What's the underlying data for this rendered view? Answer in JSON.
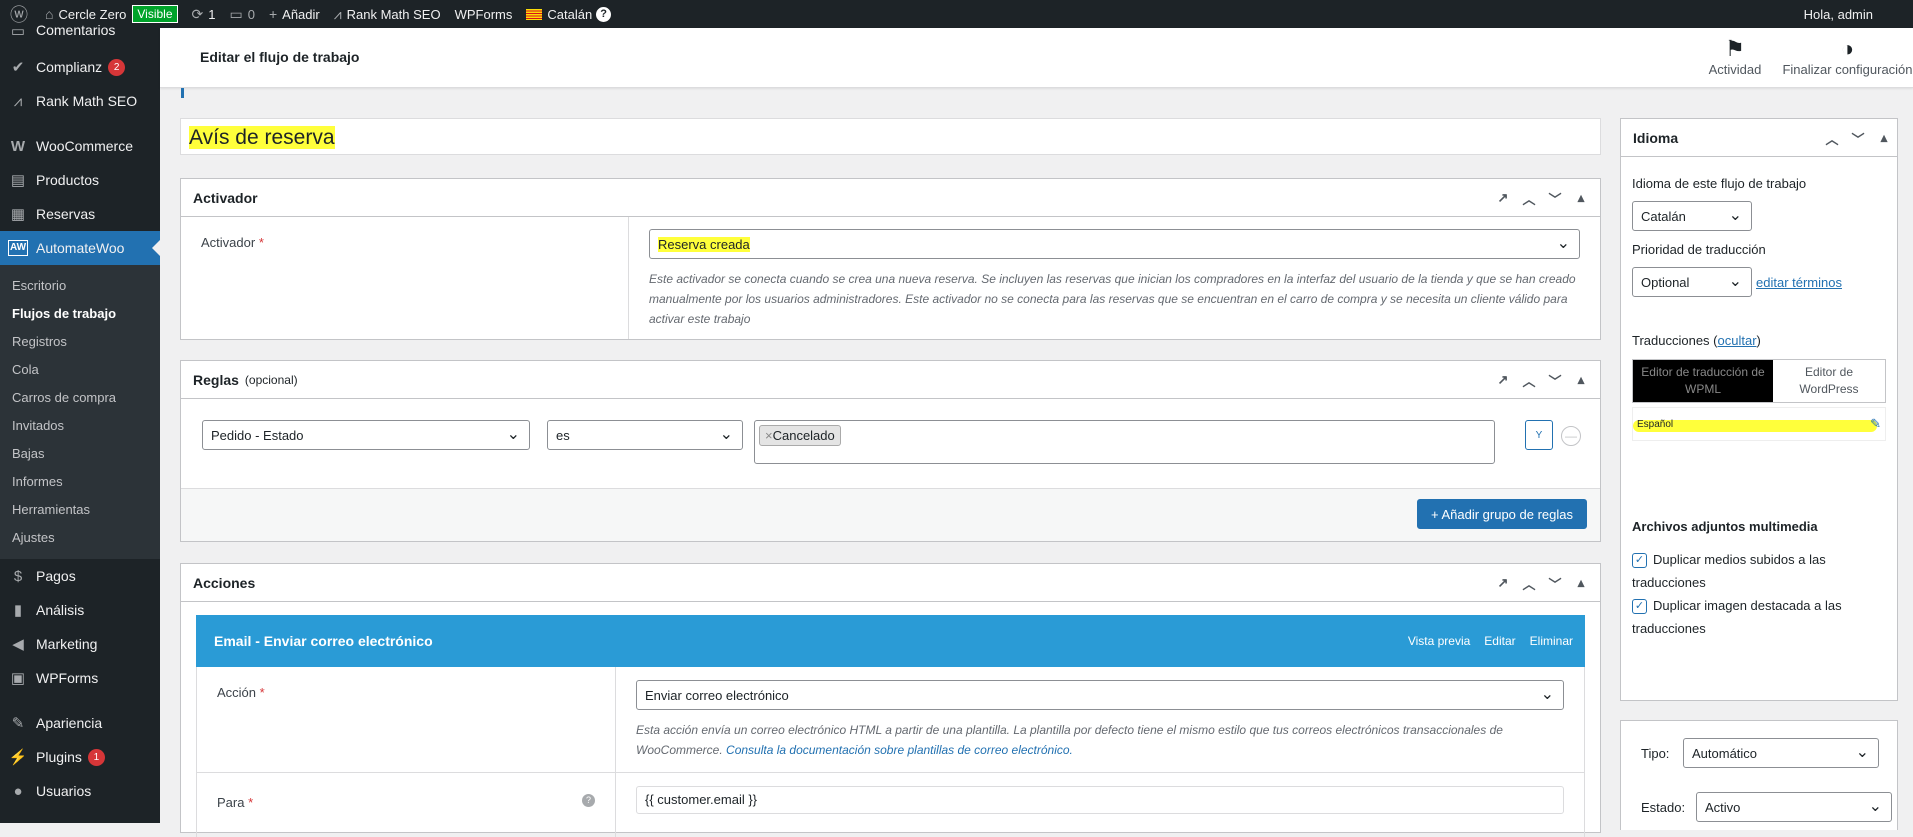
{
  "adminbar": {
    "site_name": "Cercle Zero",
    "visibility": "Visible",
    "updates_count": "1",
    "comments_count": "0",
    "add_new": "Añadir",
    "rank_math": "Rank Math SEO",
    "wpforms": "WPForms",
    "language": "Catalán",
    "help": "?",
    "greeting": "Hola, admin"
  },
  "sidebar": {
    "items": [
      {
        "label": "Comentarios",
        "icon": "comment-icon"
      },
      {
        "label": "Complianz",
        "icon": "check-icon",
        "badge": "2"
      },
      {
        "label": "Rank Math SEO",
        "icon": "chart-icon"
      },
      {
        "label": "WooCommerce",
        "icon": "woocommerce-icon"
      },
      {
        "label": "Productos",
        "icon": "archive-icon"
      },
      {
        "label": "Reservas",
        "icon": "calendar-icon"
      },
      {
        "label": "AutomateWoo",
        "icon": "automatewoo-icon"
      }
    ],
    "submenu": [
      "Escritorio",
      "Flujos de trabajo",
      "Registros",
      "Cola",
      "Carros de compra",
      "Invitados",
      "Bajas",
      "Informes",
      "Herramientas",
      "Ajustes"
    ],
    "bottom_items": [
      {
        "label": "Pagos",
        "icon": "dollar-icon"
      },
      {
        "label": "Análisis",
        "icon": "bar-chart-icon"
      },
      {
        "label": "Marketing",
        "icon": "megaphone-icon"
      },
      {
        "label": "WPForms",
        "icon": "form-icon"
      },
      {
        "label": "Apariencia",
        "icon": "paintbrush-icon"
      },
      {
        "label": "Plugins",
        "icon": "plugin-icon",
        "badge": "1"
      },
      {
        "label": "Usuarios",
        "icon": "user-icon"
      }
    ]
  },
  "header": {
    "title": "Editar el flujo de trabajo",
    "activity": "Actividad",
    "finish_setup": "Finalizar configuración"
  },
  "workflow_title": "Avís de reserva",
  "trigger": {
    "heading": "Activador",
    "label": "Activador",
    "required": "*",
    "value": "Reserva creada",
    "description": "Este activador se conecta cuando se crea una nueva reserva. Se incluyen las reservas que inician los compradores en la interfaz del usuario de la tienda y que se han creado manualmente por los usuarios administradores. Este activador no se conecta para las reservas que se encuentran en el carro de compra y se necesita un cliente válido para activar este trabajo"
  },
  "rules": {
    "heading": "Reglas",
    "optional": "(opcional)",
    "field": "Pedido - Estado",
    "operator": "es",
    "tag": "Cancelado",
    "and_button": "Y",
    "add_group": "+ Añadir grupo de reglas"
  },
  "actions": {
    "heading": "Acciones",
    "action_title": "Email - Enviar correo electrónico",
    "preview": "Vista previa",
    "edit": "Editar",
    "delete": "Eliminar",
    "action_label": "Acción",
    "action_value": "Enviar correo electrónico",
    "action_description": "Esta acción envía un correo electrónico HTML a partir de una plantilla. La plantilla por defecto tiene el mismo estilo que tus correos electrónicos transaccionales de WooCommerce.",
    "action_link": "Consulta la documentación sobre plantillas de correo electrónico.",
    "to_label": "Para",
    "to_value": "{{ customer.email }}"
  },
  "language_box": {
    "heading": "Idioma",
    "language_label": "Idioma de este flujo de trabajo",
    "language_value": "Catalán",
    "priority_label": "Prioridad de traducción",
    "priority_value": "Optional",
    "edit_terms": "editar términos",
    "translations_label": "Traducciones",
    "hide": "ocultar",
    "wpml_editor": "Editor de traducción de WPML",
    "wp_editor": "Editor de WordPress",
    "translation_lang": "Español",
    "media_heading": "Archivos adjuntos multimedia",
    "dup_media": "Duplicar medios subidos a las traducciones",
    "dup_featured": "Duplicar imagen destacada a las traducciones"
  },
  "settings_box": {
    "type_label": "Tipo:",
    "type_value": "Automático",
    "status_label": "Estado:",
    "status_value": "Activo"
  },
  "colors": {
    "accent": "#2271b1",
    "highlight": "#ffff3b",
    "action_header": "#2a9bd6"
  }
}
